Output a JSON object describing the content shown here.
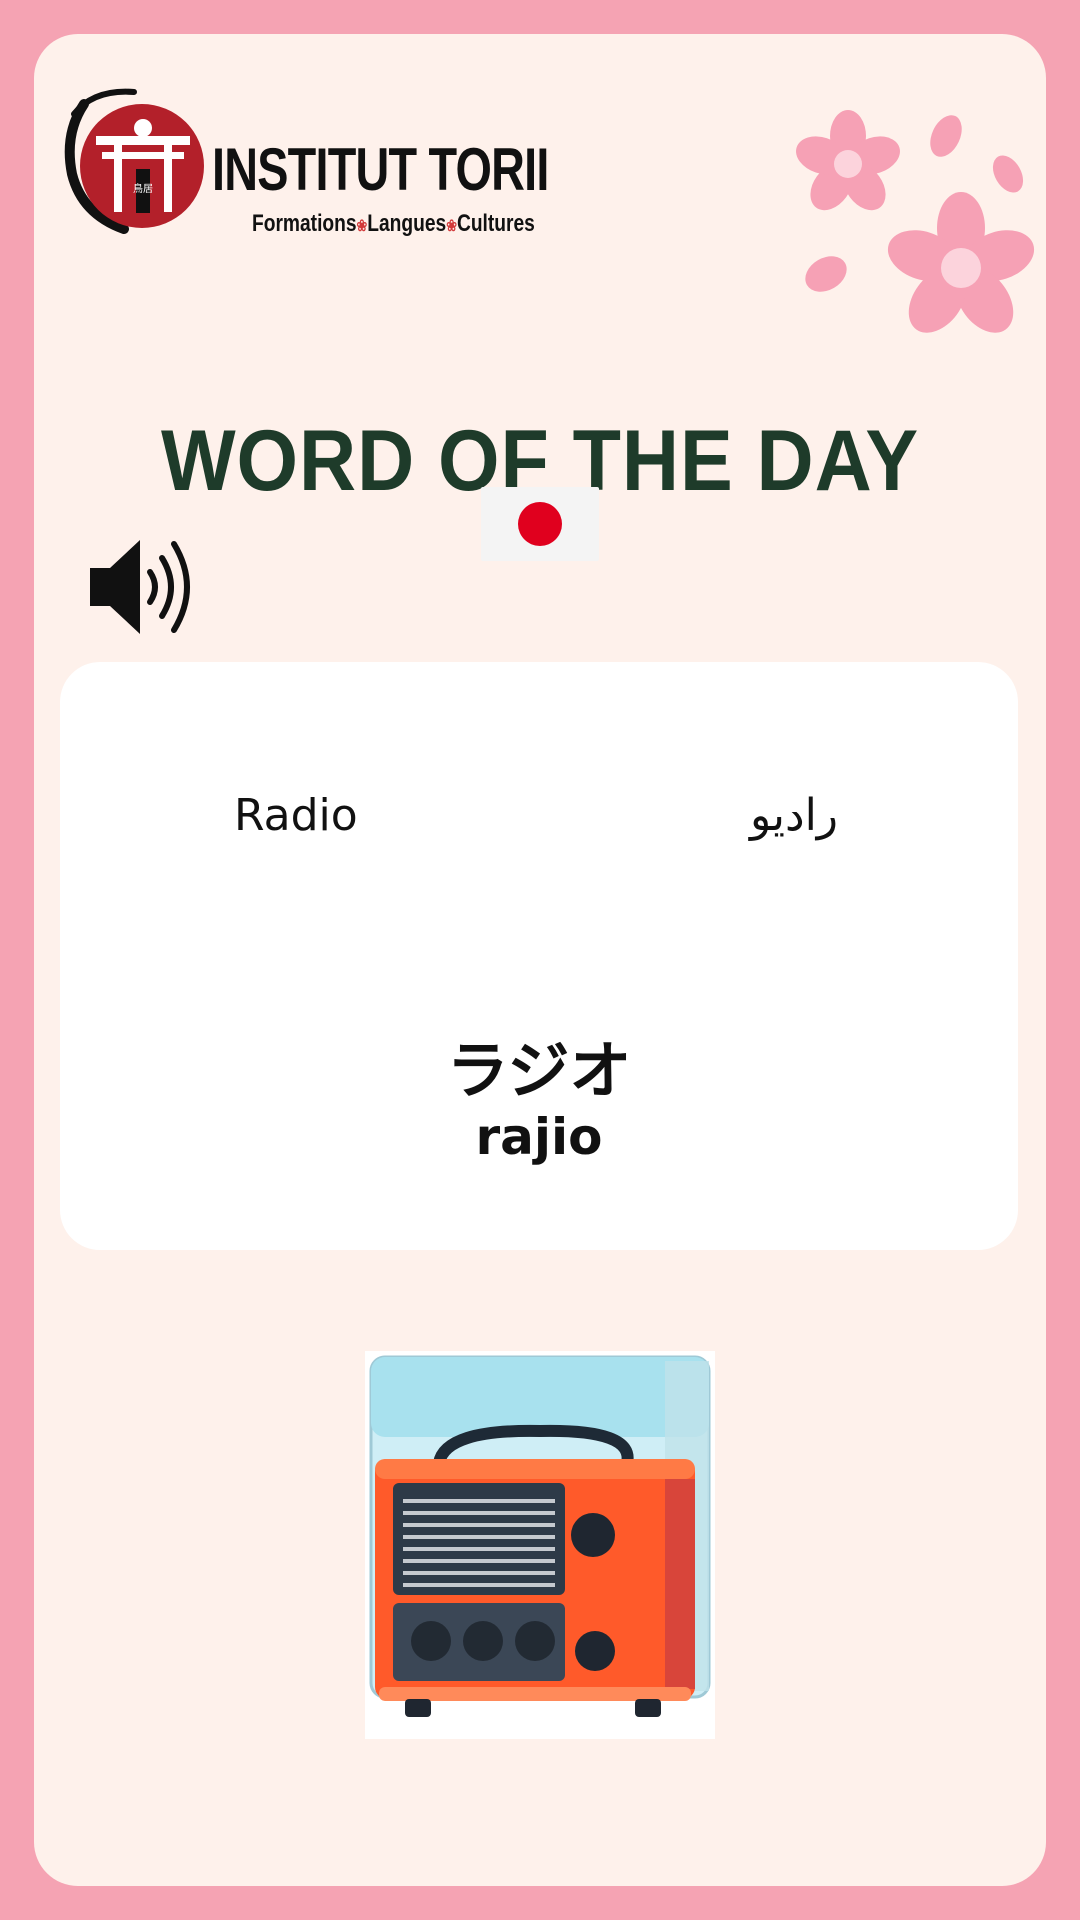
{
  "brand": {
    "name": "INSTITUT TORII",
    "tagline": [
      "Formations",
      "Langues",
      "Cultures"
    ],
    "emblem_text": "鳥居"
  },
  "header": {
    "title": "WORD OF THE DAY",
    "flag": "japan-flag-icon"
  },
  "audio": {
    "icon": "speaker-icon"
  },
  "word": {
    "french": "Radio",
    "arabic": "راديو",
    "japanese": "ラジオ",
    "romaji": "rajio"
  },
  "illustration": {
    "subject": "radio"
  },
  "colors": {
    "border": "#f5a3b3",
    "background": "#fef1eb",
    "title": "#1e3b2a",
    "flag_red": "#e0001e",
    "logo_red": "#b3202a"
  }
}
